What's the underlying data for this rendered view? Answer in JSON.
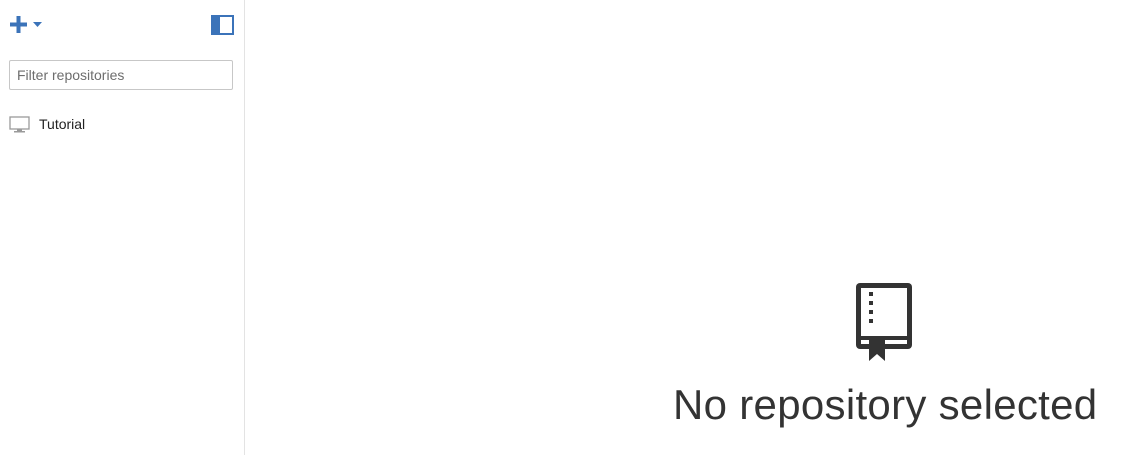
{
  "sidebar": {
    "filter": {
      "placeholder": "Filter repositories",
      "value": ""
    },
    "repositories": [
      {
        "label": "Tutorial",
        "icon": "monitor-icon"
      }
    ]
  },
  "main": {
    "empty_state": {
      "icon": "repository-book-icon",
      "message": "No repository selected"
    }
  },
  "colors": {
    "accent": "#3b73b9",
    "icon_dark": "#333333"
  }
}
